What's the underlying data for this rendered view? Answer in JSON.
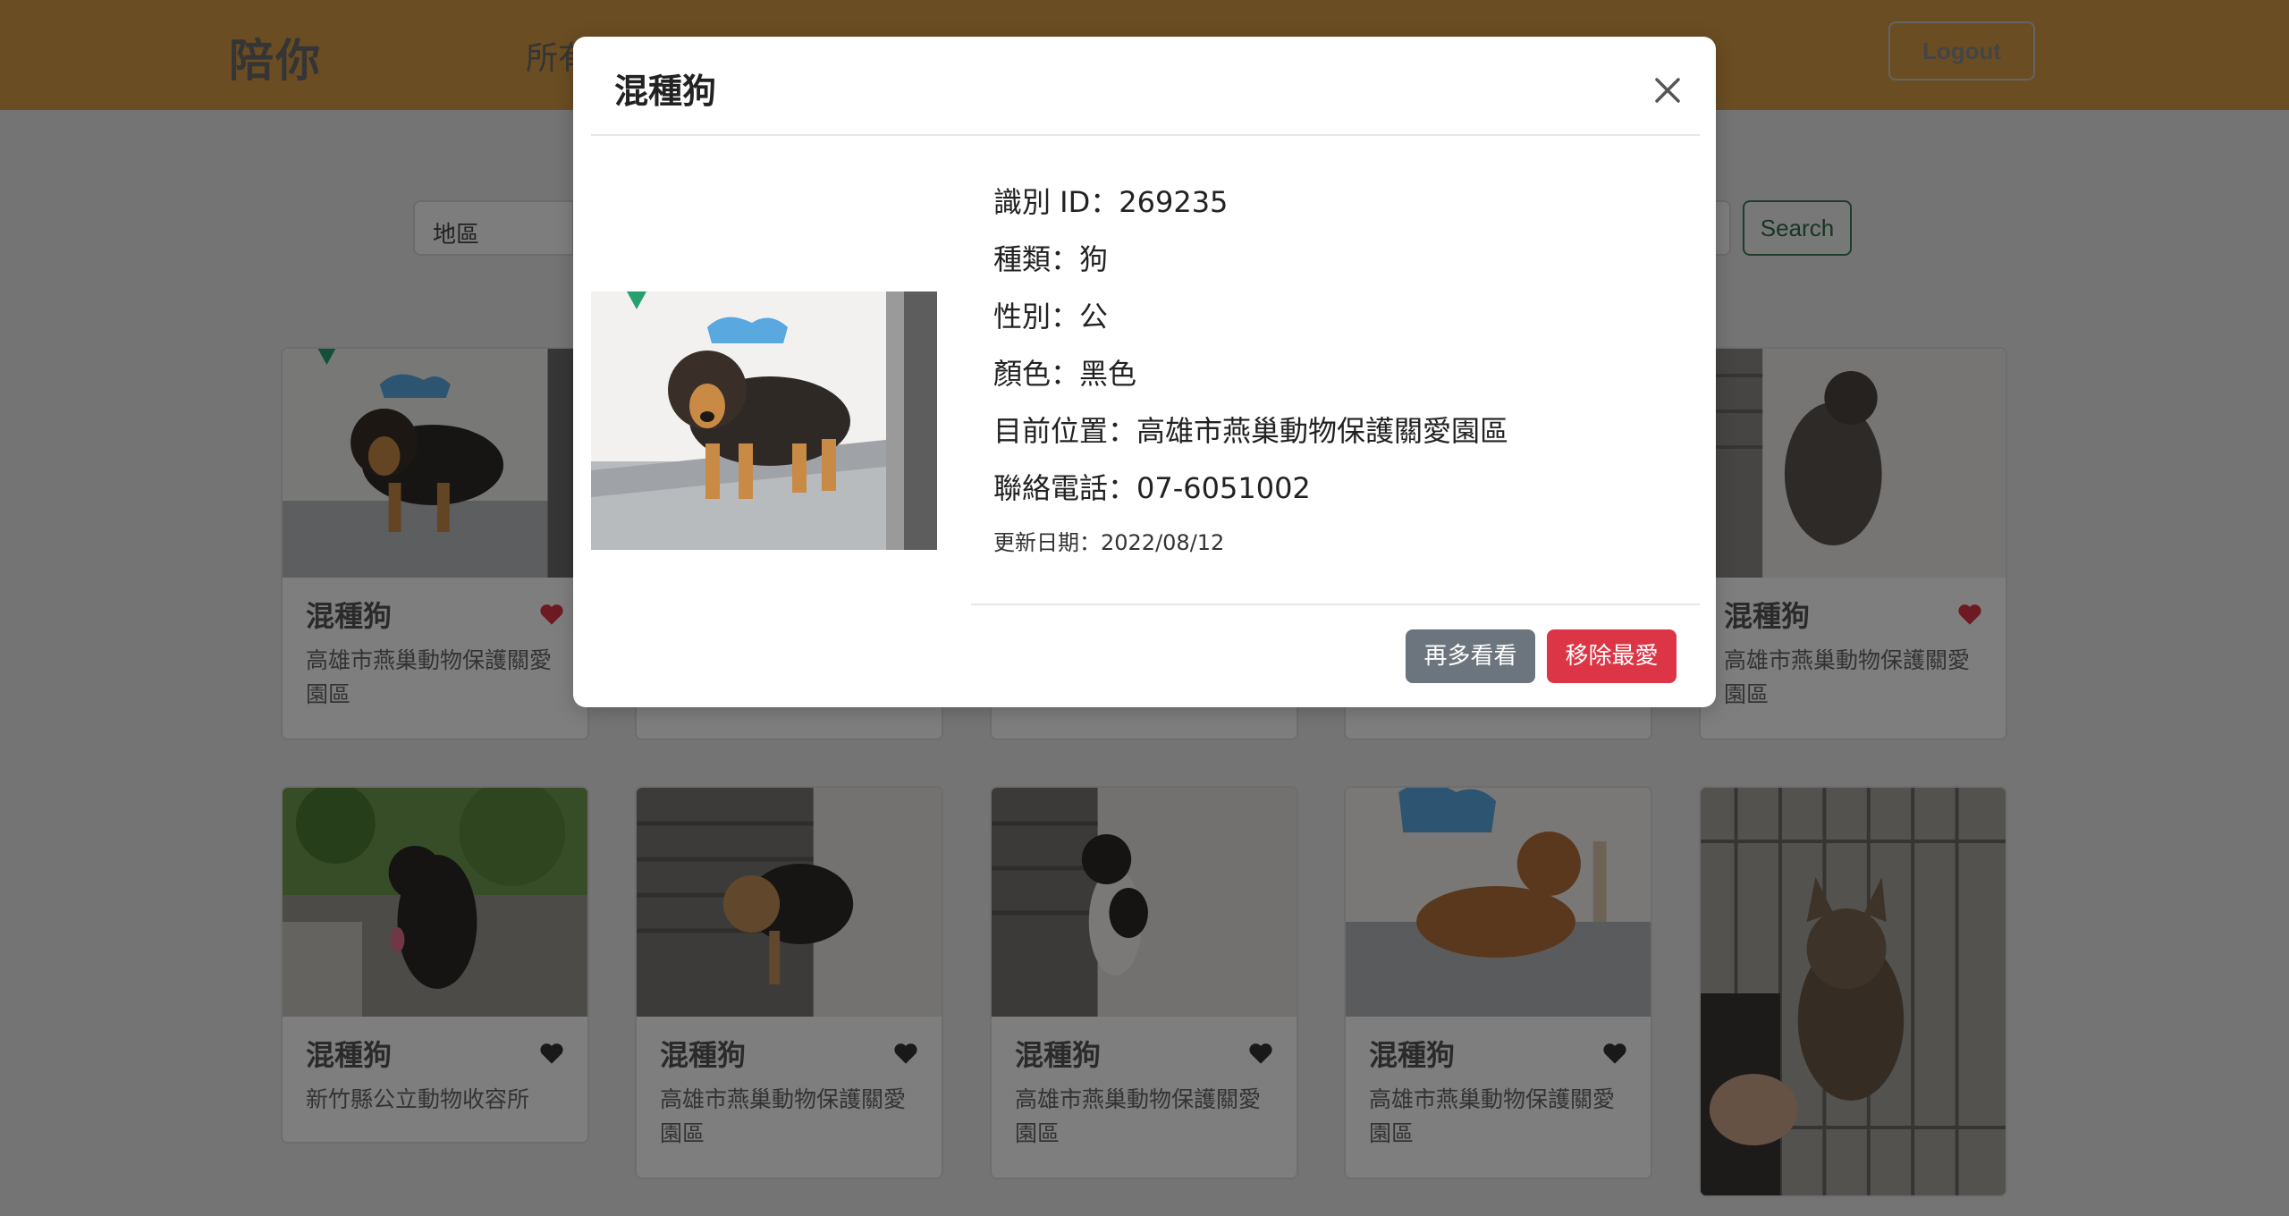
{
  "navbar": {
    "brand": "陪你",
    "nav_link_visible": "所有",
    "logout_label": "Logout"
  },
  "search": {
    "region_value": "地區",
    "button_label": "Search"
  },
  "cards": [
    {
      "title": "混種狗",
      "location": "高雄市燕巢動物保護關愛園區",
      "favorite": true
    },
    {
      "title": "",
      "location": "",
      "favorite": false
    },
    {
      "title": "",
      "location": "",
      "favorite": false
    },
    {
      "title": "",
      "location": "",
      "favorite": false
    },
    {
      "title": "混種狗",
      "location": "高雄市燕巢動物保護關愛園區",
      "favorite": true
    },
    {
      "title": "混種狗",
      "location": "新竹縣公立動物收容所",
      "favorite": false
    },
    {
      "title": "混種狗",
      "location": "高雄市燕巢動物保護關愛園區",
      "favorite": false
    },
    {
      "title": "混種狗",
      "location": "高雄市燕巢動物保護關愛園區",
      "favorite": false
    },
    {
      "title": "混種狗",
      "location": "高雄市燕巢動物保護關愛園區",
      "favorite": false
    }
  ],
  "modal": {
    "title": "混種狗",
    "id_line": "識別 ID：269235",
    "kind_line": "種類：狗",
    "sex_line": "性別：公",
    "color_line": "顏色：黑色",
    "location_line": "目前位置：高雄市燕巢動物保護關愛園區",
    "phone_line": "聯絡電話：07-6051002",
    "updated_line": "更新日期：2022/08/12",
    "more_button": "再多看看",
    "remove_button": "移除最愛"
  },
  "colors": {
    "navbar": "#d59b45",
    "heart_favorite": "#dc3545",
    "heart_default": "#333333",
    "btn_secondary": "#6c757d",
    "btn_danger": "#dc3545",
    "search_outline": "#3d7a56"
  },
  "icons": {
    "close": "close-icon",
    "heart": "heart-icon"
  }
}
